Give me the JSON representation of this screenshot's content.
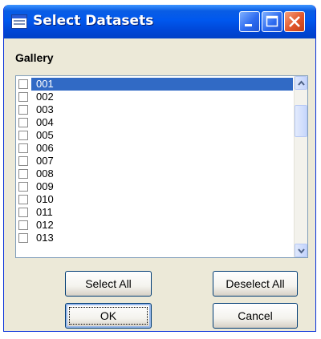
{
  "window": {
    "title": "Select Datasets",
    "controls": [
      "minimize-icon",
      "maximize-icon",
      "close-icon"
    ],
    "title_bar_color": "#0058ee",
    "close_color": "#e1562a"
  },
  "gallery": {
    "label": "Gallery",
    "items": [
      {
        "label": "001",
        "checked": false,
        "selected": true
      },
      {
        "label": "002",
        "checked": false,
        "selected": false
      },
      {
        "label": "003",
        "checked": false,
        "selected": false
      },
      {
        "label": "004",
        "checked": false,
        "selected": false
      },
      {
        "label": "005",
        "checked": false,
        "selected": false
      },
      {
        "label": "006",
        "checked": false,
        "selected": false
      },
      {
        "label": "007",
        "checked": false,
        "selected": false
      },
      {
        "label": "008",
        "checked": false,
        "selected": false
      },
      {
        "label": "009",
        "checked": false,
        "selected": false
      },
      {
        "label": "010",
        "checked": false,
        "selected": false
      },
      {
        "label": "011",
        "checked": false,
        "selected": false
      },
      {
        "label": "012",
        "checked": false,
        "selected": false
      },
      {
        "label": "013",
        "checked": false,
        "selected": false
      }
    ],
    "selection_color": "#316ac5"
  },
  "buttons": {
    "select_all": "Select All",
    "deselect_all": "Deselect All",
    "ok": "OK",
    "cancel": "Cancel"
  }
}
